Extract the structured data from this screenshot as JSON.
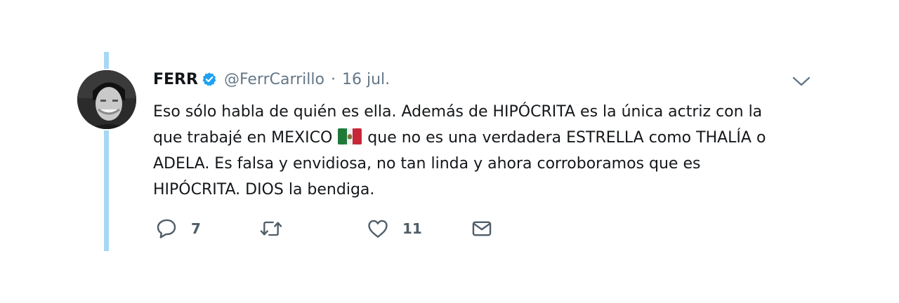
{
  "tweet": {
    "display_name": "FERR",
    "handle": "@FerrCarrillo",
    "separator": "·",
    "date": "16 jul.",
    "body": {
      "line1": "Eso sólo habla de quién es ella. Además de HIPÓCRITA es la única actriz con la",
      "line2_before_flag": "que trabajé en MEXICO",
      "line2_after_flag": "que no es una verdadera ESTRELLA como THALÍA o",
      "line3": "ADELA. Es falsa y envidiosa, no tan linda  y ahora corroboramos que es",
      "line4": "HIPÓCRITA. DIOS la bendiga."
    },
    "actions": {
      "reply_count": "7",
      "retweet_count": "",
      "like_count": "11"
    }
  },
  "colors": {
    "thread_line": "#a8d7f5",
    "verified": "#1da1f2",
    "secondary_text": "#657786",
    "icon": "#4f5d68"
  },
  "icons": [
    "verified-badge-icon",
    "chevron-down-icon",
    "mexico-flag-icon",
    "reply-icon",
    "retweet-icon",
    "like-icon",
    "direct-message-icon"
  ]
}
